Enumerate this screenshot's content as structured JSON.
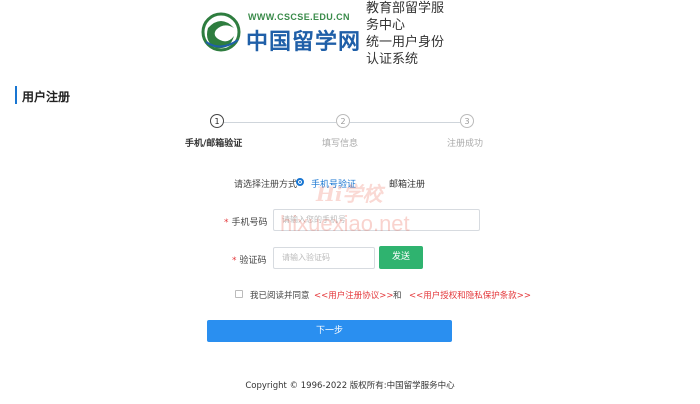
{
  "header": {
    "logo_url": "WWW.CSCSE.EDU.CN",
    "logo_cn": "中国留学网",
    "system_title_lines": [
      "教育部留学服",
      "务中心",
      "统一用户身份",
      "认证系统"
    ]
  },
  "page_title": "用户注册",
  "steps": [
    {
      "num": "1",
      "label": "手机/邮箱验证",
      "active": true
    },
    {
      "num": "2",
      "label": "填写信息",
      "active": false
    },
    {
      "num": "3",
      "label": "注册成功",
      "active": false
    }
  ],
  "form": {
    "method_label": "请选择注册方式",
    "method_phone": "手机号验证",
    "method_email": "邮箱注册",
    "phone_label": "手机号码",
    "phone_placeholder": "请输入您的手机号",
    "code_label": "验证码",
    "code_placeholder": "请输入验证码",
    "send_label": "发送",
    "agree_prefix": "我已阅读并同意",
    "agree_link1": "<<用户注册协议>>",
    "agree_and": "和",
    "agree_link2": "<<用户授权和隐私保护条款>>",
    "next_label": "下一步"
  },
  "footer": "Copyright © 1996-2022 版权所有:中国留学服务中心",
  "watermark": {
    "script": "Hi学校",
    "text": "hixuexiao.net"
  },
  "colors": {
    "primary": "#2a8ff0",
    "green": "#2fb36f",
    "link_red": "#e4393c"
  }
}
